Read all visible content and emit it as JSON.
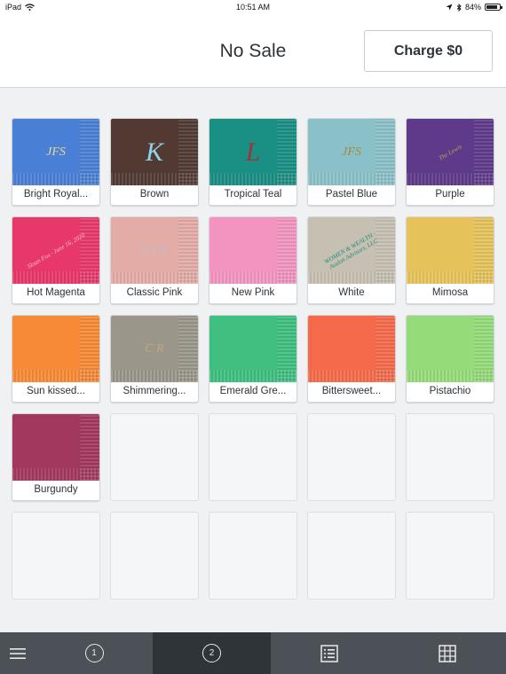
{
  "status_bar": {
    "device": "iPad",
    "time": "10:51 AM",
    "battery": "84%",
    "battery_level": 0.84
  },
  "header": {
    "title": "No Sale",
    "charge_label": "Charge $0"
  },
  "items": [
    {
      "label": "Bright Royal...",
      "color": "#4a7fd6",
      "mono": "JFS",
      "mono_color": "#e8d6a0"
    },
    {
      "label": "Brown",
      "color": "#523a33",
      "mono": "K",
      "mono_color": "#8fd3e6"
    },
    {
      "label": "Tropical Teal",
      "color": "#1a8f83",
      "mono": "L",
      "mono_color": "#a0343c"
    },
    {
      "label": "Pastel Blue",
      "color": "#8ac1c8",
      "mono": "JFS",
      "mono_color": "#a28a3c"
    },
    {
      "label": "Purple",
      "color": "#5f3a8a",
      "mono": "The Lewis",
      "mono_color": "#c9a24a"
    },
    {
      "label": "Hot Magenta",
      "color": "#e8386a",
      "mono": "Sloan Fox · June 16, 2020",
      "mono_color": "#f0c0cf"
    },
    {
      "label": "Classic Pink",
      "color": "#e4aca6",
      "mono": "S S S",
      "mono_color": "#b8c2c6"
    },
    {
      "label": "New Pink",
      "color": "#f294bf",
      "mono": "",
      "mono_color": "#ffffff"
    },
    {
      "label": "White",
      "color": "#c6c0b2",
      "mono": "WOMEN & WEALTH · Avalon Advisors, LLC",
      "mono_color": "#1f8a78"
    },
    {
      "label": "Mimosa",
      "color": "#e6c35a",
      "mono": "",
      "mono_color": "#ffffff"
    },
    {
      "label": "Sun kissed...",
      "color": "#f78a36",
      "mono": "",
      "mono_color": "#ffffff"
    },
    {
      "label": "Shimmering...",
      "color": "#9a968a",
      "mono": "C R",
      "mono_color": "#c4a97a"
    },
    {
      "label": "Emerald Gre...",
      "color": "#3fbf80",
      "mono": "",
      "mono_color": "#ffffff"
    },
    {
      "label": "Bittersweet...",
      "color": "#f56a4a",
      "mono": "",
      "mono_color": "#ffffff"
    },
    {
      "label": "Pistachio",
      "color": "#96db7a",
      "mono": "",
      "mono_color": "#ffffff"
    },
    {
      "label": "Burgundy",
      "color": "#a3385f",
      "mono": "",
      "mono_color": "#ffffff"
    }
  ],
  "empty_tiles": 9,
  "tabbar": {
    "tabs": [
      {
        "name": "menu",
        "icon": "hamburger-menu-icon",
        "label": ""
      },
      {
        "name": "page-1",
        "icon": "circle-number-icon",
        "label": "1"
      },
      {
        "name": "page-2",
        "icon": "circle-number-icon",
        "label": "2",
        "active": true
      },
      {
        "name": "list",
        "icon": "list-view-icon",
        "label": ""
      },
      {
        "name": "grid",
        "icon": "grid-view-icon",
        "label": ""
      }
    ]
  }
}
